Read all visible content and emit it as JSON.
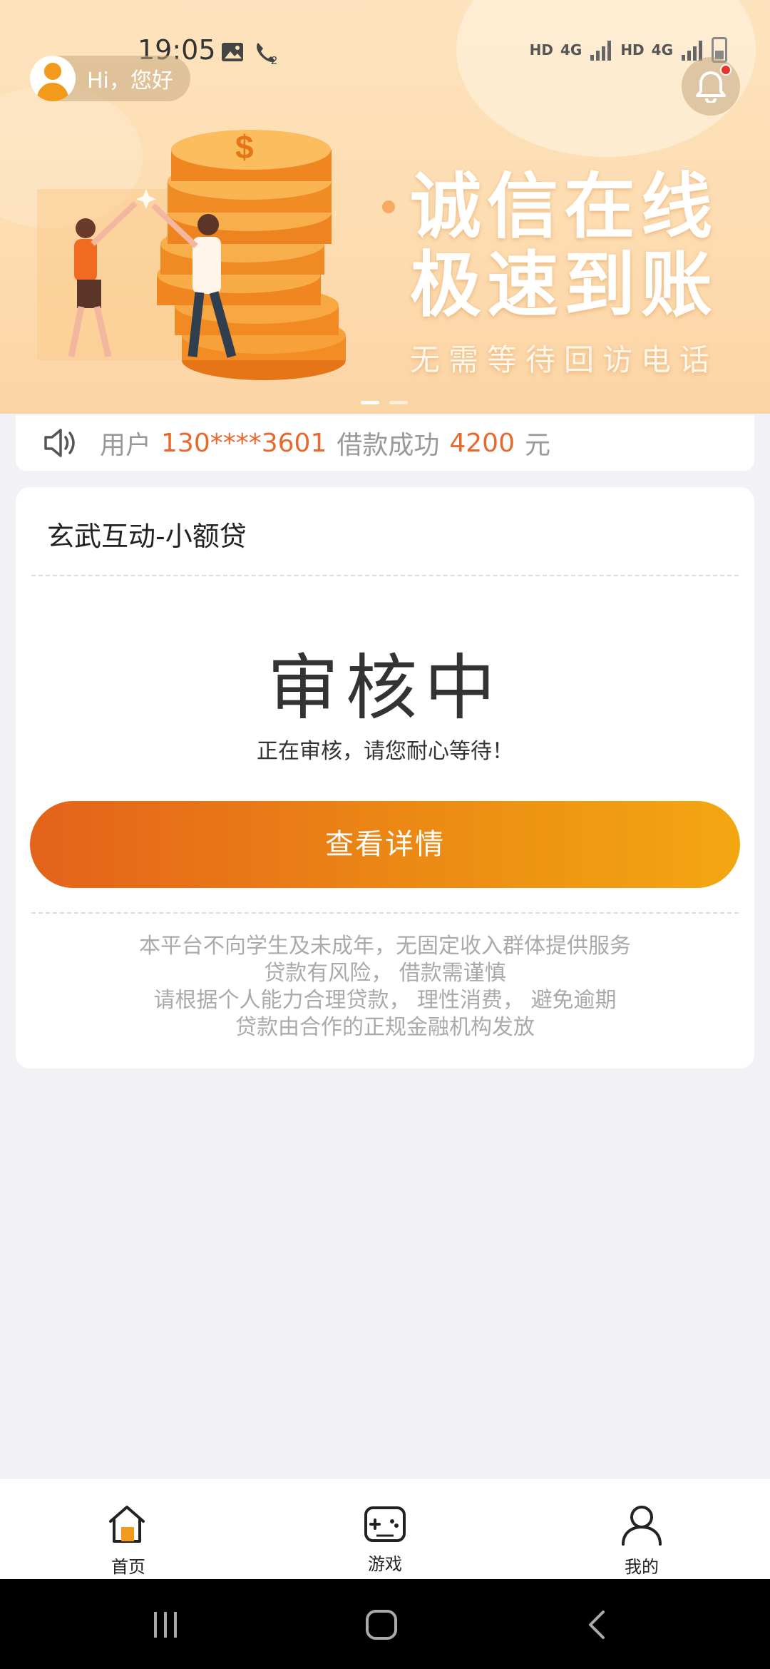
{
  "status_bar": {
    "time": "19:05",
    "indicators": [
      "HD",
      "4G",
      "HD",
      "4G"
    ]
  },
  "header": {
    "greeting": "Hi，您好",
    "avatar_icon": "user-avatar-icon",
    "bell_icon": "bell-icon",
    "has_unread": true
  },
  "banner": {
    "line1": "诚信在线",
    "line2": "极速到账",
    "line3": "无需等待回访电话",
    "slide_count": 2,
    "active_slide": 1
  },
  "notice": {
    "prefix": "用户",
    "phone": "130****3601",
    "middle": "借款成功",
    "amount": "4200",
    "unit": "元"
  },
  "card": {
    "title": "玄武互动-小额贷",
    "status": "审核中",
    "status_desc": "正在审核，请您耐心等待！",
    "button_label": "查看详情",
    "disclaimer": [
      "本平台不向学生及未成年，无固定收入群体提供服务",
      "贷款有风险， 借款需谨慎",
      "请根据个人能力合理贷款， 理性消费， 避免逾期",
      "贷款由合作的正规金融机构发放"
    ]
  },
  "tabbar": {
    "items": [
      {
        "label": "首页",
        "icon": "home-icon",
        "active": true
      },
      {
        "label": "游戏",
        "icon": "gamepad-icon",
        "active": false
      },
      {
        "label": "我的",
        "icon": "person-icon",
        "active": false
      }
    ]
  },
  "colors": {
    "accent": "#e8692e",
    "button_start": "#e4621b",
    "button_end": "#f3a711",
    "banner_bg": "#fddcb0"
  }
}
